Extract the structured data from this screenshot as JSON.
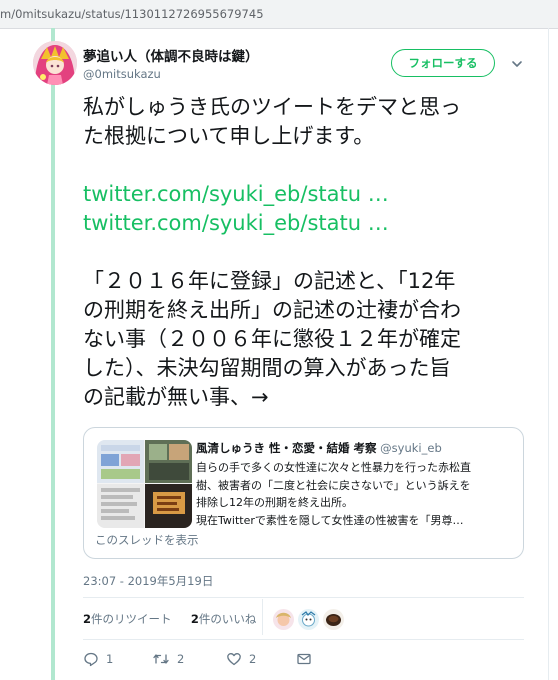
{
  "browser": {
    "url": "m/0mitsukazu/status/1130112726955679745"
  },
  "author": {
    "display_name": "夢追い人（体調不良時は鍵）",
    "handle": "@0mitsukazu"
  },
  "follow_button": "フォローする",
  "tweet": {
    "line1": "私がしゅうき氏のツイートをデマと思っ",
    "line2": "た根拠について申し上げます。",
    "link1": "twitter.com/syuki_eb/statu …",
    "link2": "twitter.com/syuki_eb/statu …",
    "para2": [
      "「２０１６年に登録」の記述と、「12年",
      "の刑期を終え出所」の記述の辻褄が合わ",
      "ない事（２００６年に懲役１２年が確定",
      "した）、未決勾留期間の算入があった旨",
      "の記載が無い事、→"
    ]
  },
  "quote": {
    "name": "風清しゅうき 性・恋愛・結婚 考察",
    "handle": "@syuki_eb",
    "lines": [
      "自らの手で多くの女性達に次々と性暴力を行った赤松直",
      "樹、被害者の「二度と社会に戻さないで」という訴えを",
      "排除し12年の刑期を終え出所。",
      "現在Twitterで素性を隠して女性達の性被害を「男尊…"
    ],
    "show_thread": "このスレッドを表示"
  },
  "timestamp": "23:07 - 2019年5月19日",
  "stats": {
    "retweets_count": "2",
    "retweets_label": "件のリツイート",
    "likes_count": "2",
    "likes_label": "件のいいね"
  },
  "actions": {
    "reply_count": "1",
    "retweet_count": "2",
    "like_count": "2"
  },
  "colors": {
    "accent": "#17bf63",
    "thread_line": "#b1e7cf",
    "secondary_text": "#657786"
  },
  "icons": [
    "chevron-down-icon",
    "reply-icon",
    "retweet-icon",
    "heart-icon",
    "message-icon"
  ]
}
